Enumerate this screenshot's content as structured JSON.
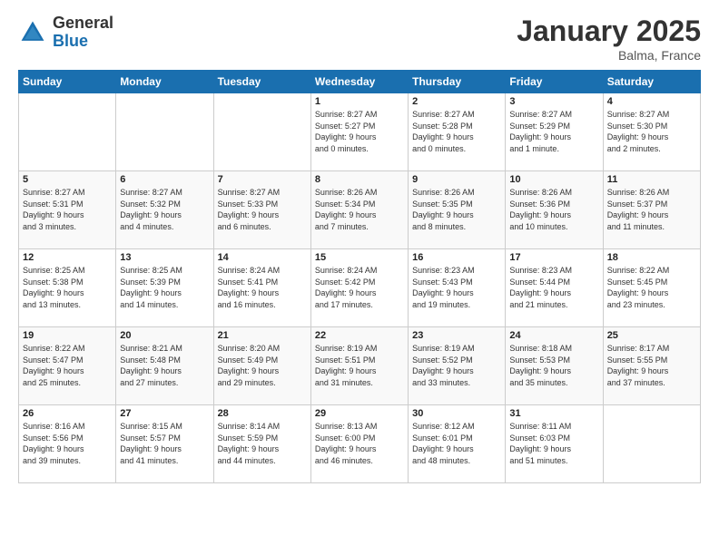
{
  "header": {
    "logo_general": "General",
    "logo_blue": "Blue",
    "title": "January 2025",
    "location": "Balma, France"
  },
  "weekdays": [
    "Sunday",
    "Monday",
    "Tuesday",
    "Wednesday",
    "Thursday",
    "Friday",
    "Saturday"
  ],
  "weeks": [
    [
      {
        "day": "",
        "info": ""
      },
      {
        "day": "",
        "info": ""
      },
      {
        "day": "",
        "info": ""
      },
      {
        "day": "1",
        "info": "Sunrise: 8:27 AM\nSunset: 5:27 PM\nDaylight: 9 hours\nand 0 minutes."
      },
      {
        "day": "2",
        "info": "Sunrise: 8:27 AM\nSunset: 5:28 PM\nDaylight: 9 hours\nand 0 minutes."
      },
      {
        "day": "3",
        "info": "Sunrise: 8:27 AM\nSunset: 5:29 PM\nDaylight: 9 hours\nand 1 minute."
      },
      {
        "day": "4",
        "info": "Sunrise: 8:27 AM\nSunset: 5:30 PM\nDaylight: 9 hours\nand 2 minutes."
      }
    ],
    [
      {
        "day": "5",
        "info": "Sunrise: 8:27 AM\nSunset: 5:31 PM\nDaylight: 9 hours\nand 3 minutes."
      },
      {
        "day": "6",
        "info": "Sunrise: 8:27 AM\nSunset: 5:32 PM\nDaylight: 9 hours\nand 4 minutes."
      },
      {
        "day": "7",
        "info": "Sunrise: 8:27 AM\nSunset: 5:33 PM\nDaylight: 9 hours\nand 6 minutes."
      },
      {
        "day": "8",
        "info": "Sunrise: 8:26 AM\nSunset: 5:34 PM\nDaylight: 9 hours\nand 7 minutes."
      },
      {
        "day": "9",
        "info": "Sunrise: 8:26 AM\nSunset: 5:35 PM\nDaylight: 9 hours\nand 8 minutes."
      },
      {
        "day": "10",
        "info": "Sunrise: 8:26 AM\nSunset: 5:36 PM\nDaylight: 9 hours\nand 10 minutes."
      },
      {
        "day": "11",
        "info": "Sunrise: 8:26 AM\nSunset: 5:37 PM\nDaylight: 9 hours\nand 11 minutes."
      }
    ],
    [
      {
        "day": "12",
        "info": "Sunrise: 8:25 AM\nSunset: 5:38 PM\nDaylight: 9 hours\nand 13 minutes."
      },
      {
        "day": "13",
        "info": "Sunrise: 8:25 AM\nSunset: 5:39 PM\nDaylight: 9 hours\nand 14 minutes."
      },
      {
        "day": "14",
        "info": "Sunrise: 8:24 AM\nSunset: 5:41 PM\nDaylight: 9 hours\nand 16 minutes."
      },
      {
        "day": "15",
        "info": "Sunrise: 8:24 AM\nSunset: 5:42 PM\nDaylight: 9 hours\nand 17 minutes."
      },
      {
        "day": "16",
        "info": "Sunrise: 8:23 AM\nSunset: 5:43 PM\nDaylight: 9 hours\nand 19 minutes."
      },
      {
        "day": "17",
        "info": "Sunrise: 8:23 AM\nSunset: 5:44 PM\nDaylight: 9 hours\nand 21 minutes."
      },
      {
        "day": "18",
        "info": "Sunrise: 8:22 AM\nSunset: 5:45 PM\nDaylight: 9 hours\nand 23 minutes."
      }
    ],
    [
      {
        "day": "19",
        "info": "Sunrise: 8:22 AM\nSunset: 5:47 PM\nDaylight: 9 hours\nand 25 minutes."
      },
      {
        "day": "20",
        "info": "Sunrise: 8:21 AM\nSunset: 5:48 PM\nDaylight: 9 hours\nand 27 minutes."
      },
      {
        "day": "21",
        "info": "Sunrise: 8:20 AM\nSunset: 5:49 PM\nDaylight: 9 hours\nand 29 minutes."
      },
      {
        "day": "22",
        "info": "Sunrise: 8:19 AM\nSunset: 5:51 PM\nDaylight: 9 hours\nand 31 minutes."
      },
      {
        "day": "23",
        "info": "Sunrise: 8:19 AM\nSunset: 5:52 PM\nDaylight: 9 hours\nand 33 minutes."
      },
      {
        "day": "24",
        "info": "Sunrise: 8:18 AM\nSunset: 5:53 PM\nDaylight: 9 hours\nand 35 minutes."
      },
      {
        "day": "25",
        "info": "Sunrise: 8:17 AM\nSunset: 5:55 PM\nDaylight: 9 hours\nand 37 minutes."
      }
    ],
    [
      {
        "day": "26",
        "info": "Sunrise: 8:16 AM\nSunset: 5:56 PM\nDaylight: 9 hours\nand 39 minutes."
      },
      {
        "day": "27",
        "info": "Sunrise: 8:15 AM\nSunset: 5:57 PM\nDaylight: 9 hours\nand 41 minutes."
      },
      {
        "day": "28",
        "info": "Sunrise: 8:14 AM\nSunset: 5:59 PM\nDaylight: 9 hours\nand 44 minutes."
      },
      {
        "day": "29",
        "info": "Sunrise: 8:13 AM\nSunset: 6:00 PM\nDaylight: 9 hours\nand 46 minutes."
      },
      {
        "day": "30",
        "info": "Sunrise: 8:12 AM\nSunset: 6:01 PM\nDaylight: 9 hours\nand 48 minutes."
      },
      {
        "day": "31",
        "info": "Sunrise: 8:11 AM\nSunset: 6:03 PM\nDaylight: 9 hours\nand 51 minutes."
      },
      {
        "day": "",
        "info": ""
      }
    ]
  ]
}
